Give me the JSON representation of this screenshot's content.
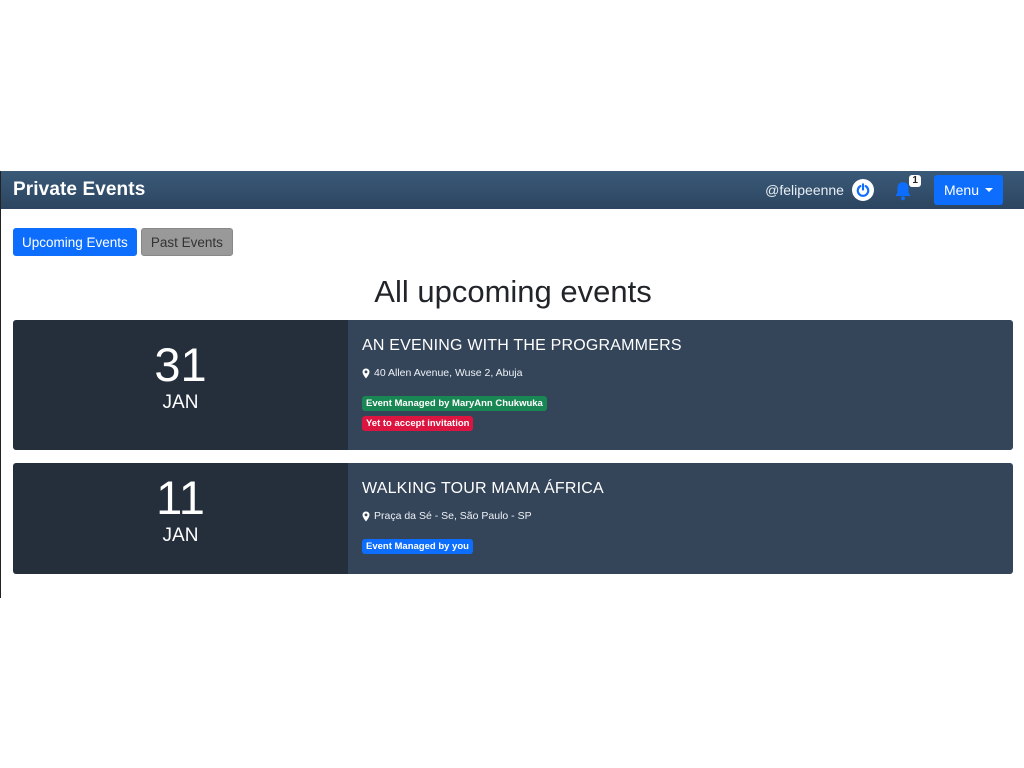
{
  "navbar": {
    "brand": "Private Events",
    "username": "@felipeenne",
    "notification_count": "1",
    "menu_label": "Menu"
  },
  "tabs": [
    {
      "label": "Upcoming Events",
      "active": true
    },
    {
      "label": "Past Events",
      "active": false
    }
  ],
  "page_title": "All upcoming events",
  "events": [
    {
      "day": "31",
      "month": "JAN",
      "title": "AN EVENING WITH THE PROGRAMMERS",
      "location": "40 Allen Avenue, Wuse 2, Abuja",
      "badges": [
        {
          "text": "Event Managed by MaryAnn Chukwuka",
          "color": "#198754"
        },
        {
          "text": "Yet to accept invitation",
          "color": "#dc1440"
        }
      ]
    },
    {
      "day": "11",
      "month": "JAN",
      "title": "WALKING TOUR MAMA ÁFRICA",
      "location": "Praça da Sé - Se, São Paulo - SP",
      "badges": [
        {
          "text": "Event Managed by you",
          "color": "#0d6efd"
        }
      ]
    }
  ],
  "colors": {
    "navbar": "#2c4560",
    "primary": "#0d6efd",
    "date_block": "#252f3c",
    "info_block": "#344459"
  },
  "icons": {
    "power": "power-icon",
    "bell": "bell-icon",
    "location": "map-marker-icon",
    "menu_caret": "caret-down-icon"
  }
}
